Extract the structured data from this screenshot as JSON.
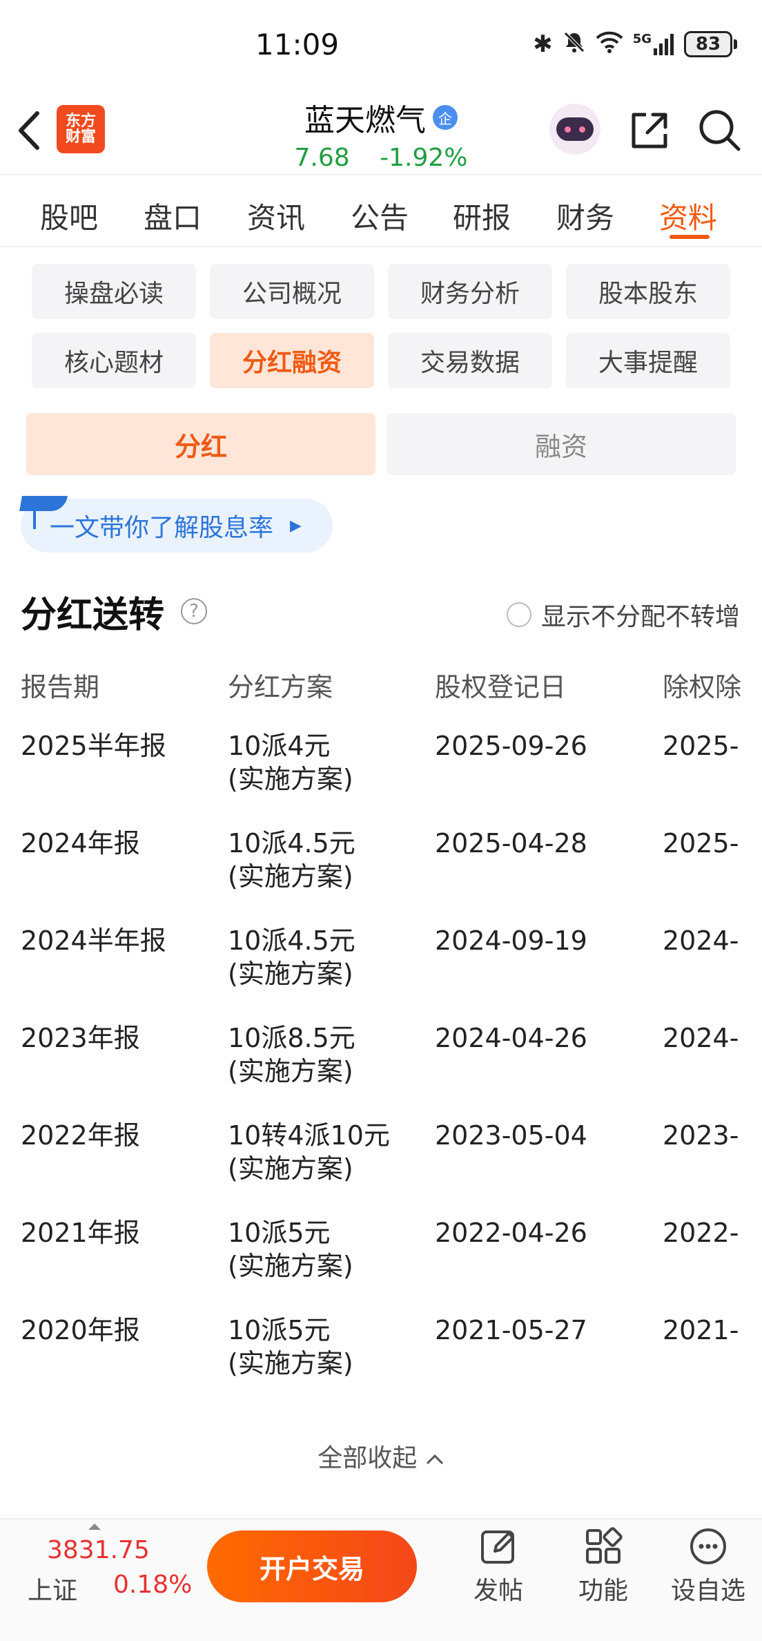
{
  "status": {
    "time": "11:09",
    "network": "5G",
    "battery": "83"
  },
  "header": {
    "logo_line1": "东方",
    "logo_line2": "财富",
    "stock_name": "蓝天燃气",
    "badge": "企",
    "price": "7.68",
    "change_pct": "-1.92%",
    "colors": {
      "down": "#1e9e40",
      "accent": "#f05a12"
    }
  },
  "tabs": [
    "股吧",
    "盘口",
    "资讯",
    "公告",
    "研报",
    "财务",
    "资料"
  ],
  "active_tab": "资料",
  "subnav": [
    "操盘必读",
    "公司概况",
    "财务分析",
    "股本股东",
    "核心题材",
    "分红融资",
    "交易数据",
    "大事提醒"
  ],
  "active_subnav": "分红融资",
  "segments": {
    "dividend": "分红",
    "financing": "融资"
  },
  "promo": {
    "text": "一文带你了解股息率",
    "arrow": "▶"
  },
  "section": {
    "title": "分红送转",
    "help": "?",
    "toggle_label": "显示不分配不转增"
  },
  "table": {
    "headers": [
      "报告期",
      "分红方案",
      "股权登记日",
      "除权除"
    ],
    "rows": [
      {
        "period": "2025半年报",
        "plan": "10派4元",
        "status": "(实施方案)",
        "record_date": "2025-09-26",
        "ex_date": "2025-"
      },
      {
        "period": "2024年报",
        "plan": "10派4.5元",
        "status": "(实施方案)",
        "record_date": "2025-04-28",
        "ex_date": "2025-"
      },
      {
        "period": "2024半年报",
        "plan": "10派4.5元",
        "status": "(实施方案)",
        "record_date": "2024-09-19",
        "ex_date": "2024-"
      },
      {
        "period": "2023年报",
        "plan": "10派8.5元",
        "status": "(实施方案)",
        "record_date": "2024-04-26",
        "ex_date": "2024-"
      },
      {
        "period": "2022年报",
        "plan": "10转4派10元",
        "status": "(实施方案)",
        "record_date": "2023-05-04",
        "ex_date": "2023-"
      },
      {
        "period": "2021年报",
        "plan": "10派5元",
        "status": "(实施方案)",
        "record_date": "2022-04-26",
        "ex_date": "2022-"
      },
      {
        "period": "2020年报",
        "plan": "10派5元",
        "status": "(实施方案)",
        "record_date": "2021-05-27",
        "ex_date": "2021-"
      }
    ]
  },
  "collapse_label": "全部收起",
  "bottom": {
    "index_value": "3831.75",
    "index_name": "上证",
    "index_pct": "0.18%",
    "trade_button": "开户交易",
    "post": "发帖",
    "functions": "功能",
    "watchlist": "设自选"
  }
}
